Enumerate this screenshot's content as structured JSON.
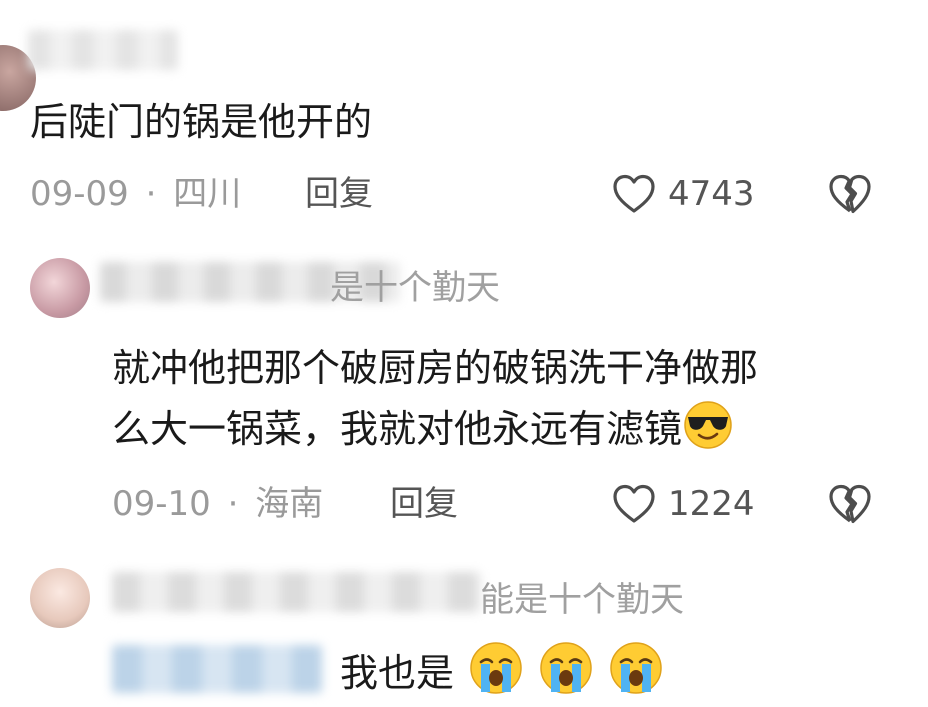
{
  "comments": [
    {
      "text": "后陡门的锅是他开的",
      "date": "09-09",
      "separator": "·",
      "location": "四川",
      "reply_label": "回复",
      "likes": "4743"
    },
    {
      "reply_to_tail": "是十个勤天",
      "text_line1": "就冲他把那个破厨房的破锅洗干净做那",
      "text_line2": "么大一锅菜，我就对他永远有滤镜",
      "emoji": "sunglasses-face",
      "date": "09-10",
      "separator": "·",
      "location": "海南",
      "reply_label": "回复",
      "likes": "1224"
    },
    {
      "reply_to_tail": "能是十个勤天",
      "text": "我也是",
      "emojis": [
        "crying-face",
        "crying-face",
        "crying-face"
      ]
    }
  ],
  "colors": {
    "text": "#1a1a1a",
    "meta": "#9a9a9a",
    "icon": "#4d4d4d"
  }
}
